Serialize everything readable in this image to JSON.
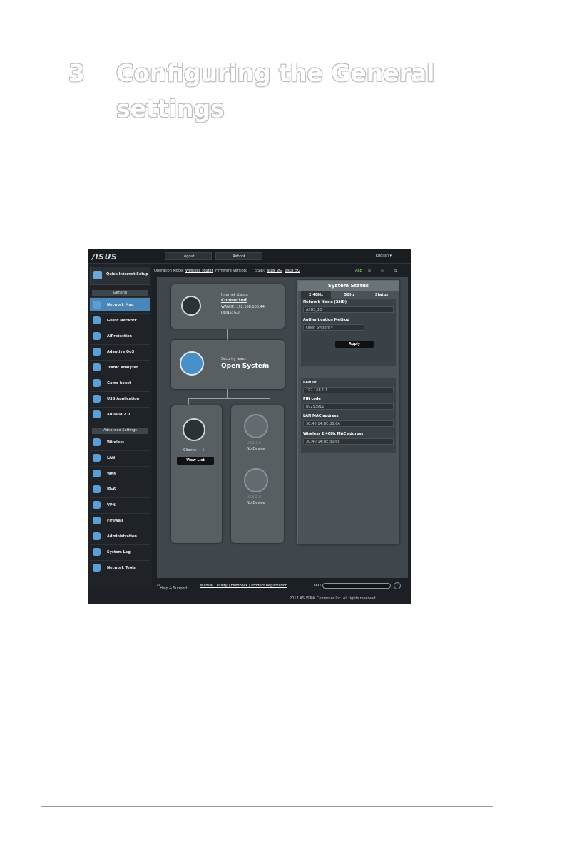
{
  "doc": {
    "chapter_number": "3",
    "chapter_title_line1": "Configuring the General",
    "chapter_title_line2": "settings"
  },
  "screenshot": {
    "logo": "/ISUS",
    "topbar": {
      "logout": "Logout",
      "reboot": "Reboot",
      "language": "English"
    },
    "opbar": {
      "operation_mode_label": "Operation Mode:",
      "operation_mode_value": "Wireless_router",
      "firmware_label": "Firmware Version:",
      "ssid_label": "SSID:",
      "ssid_1": "asus_2G",
      "ssid_2": "asus_5G",
      "app_label": "App"
    },
    "sidebar": {
      "quick_setup": "Quick Internet Setup",
      "general_title": "General",
      "general_items": [
        "Network Map",
        "Guest Network",
        "AiProtection",
        "Adaptive QoS",
        "Traffic Analyzer",
        "Game boost",
        "USB Application",
        "AiCloud 2.0"
      ],
      "advanced_title": "Advanced Settings",
      "advanced_items": [
        "Wireless",
        "LAN",
        "WAN",
        "IPv6",
        "VPN",
        "Firewall",
        "Administration",
        "System Log",
        "Network Tools"
      ]
    },
    "map": {
      "internet_status_label": "Internet status:",
      "internet_status_value": "Connected",
      "wan_ip": "WAN IP: 192.168.100.44",
      "ddns": "DDNS: GO",
      "security_label": "Security level:",
      "security_value": "Open System",
      "clients_label": "Clients:",
      "clients_count": "1",
      "view_list": "View List",
      "usb1": "USB 3.0",
      "usb2": "USB 2.0",
      "no_device": "No Device"
    },
    "status": {
      "title": "System Status",
      "tabs": [
        "2.4GHz",
        "5GHz",
        "Status"
      ],
      "ssid_label": "Network Name (SSID)",
      "ssid_value": "ASUS_2G",
      "auth_label": "Authentication Method",
      "auth_value": "Open System",
      "apply": "Apply",
      "lan_ip_label": "LAN IP",
      "lan_ip_value": "192.168.1.1",
      "pin_label": "PIN code",
      "pin_value": "89253911",
      "lan_mac_label": "LAN MAC address",
      "lan_mac_value": "3C:40:14:DE:30:6A",
      "wl_mac_label": "Wireless 2.4GHz MAC address",
      "wl_mac_value": "3C:40:14:DE:30:68"
    },
    "bottombar": {
      "help": "Help & Support",
      "links": "Manual | Utility | Feedback | Product Registration",
      "faq": "FAQ"
    },
    "copyright": "2017 ASUSTeK Computer Inc. All rights reserved."
  }
}
